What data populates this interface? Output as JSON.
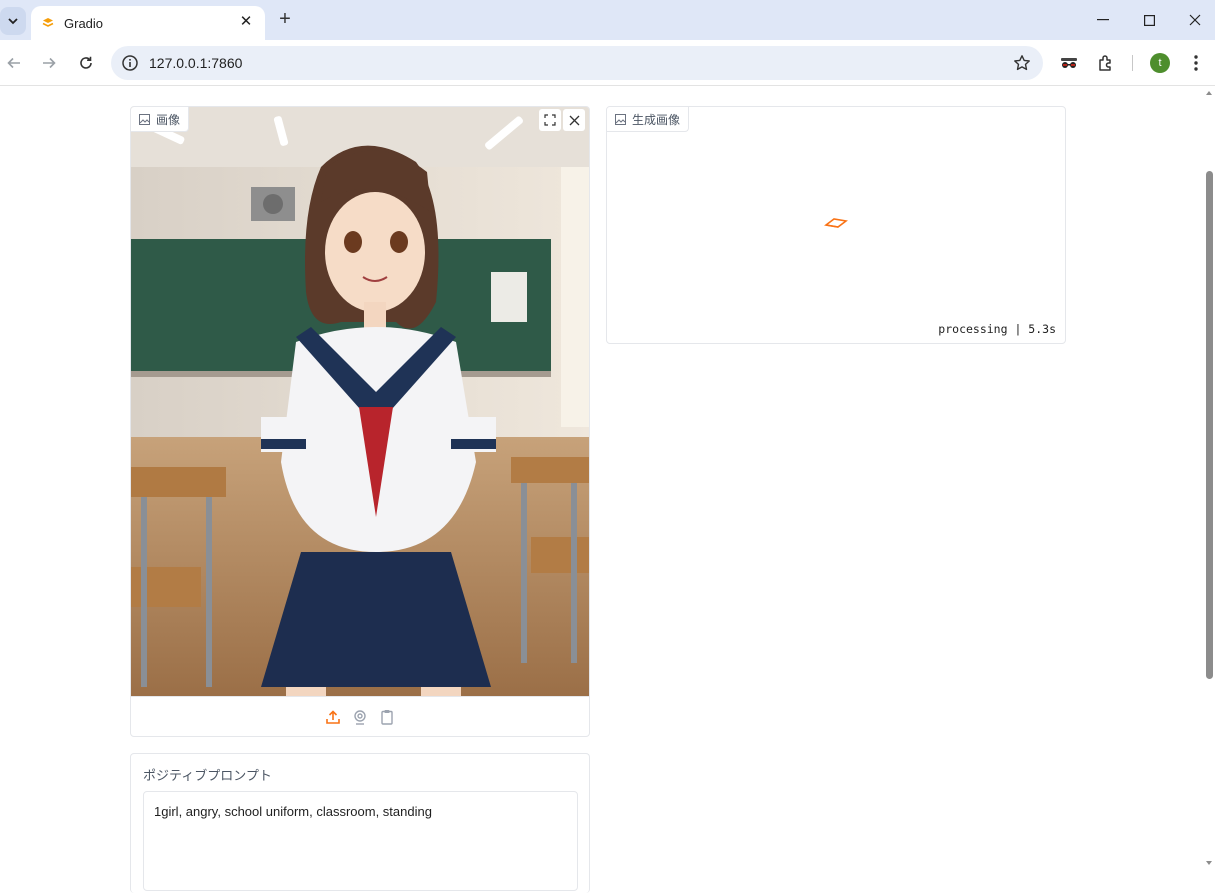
{
  "browser": {
    "tab_title": "Gradio",
    "url": "127.0.0.1:7860",
    "avatar_letter": "t",
    "icons": [
      "tab-search-icon",
      "gradio-favicon-icon",
      "close-icon",
      "plus-icon",
      "minimize-icon",
      "maximize-icon",
      "window-close-icon",
      "back-icon",
      "forward-icon",
      "reload-icon",
      "site-info-icon",
      "bookmark-star-icon",
      "incognito-icon",
      "extensions-icon",
      "kebab-menu-icon"
    ]
  },
  "input_image": {
    "label": "画像",
    "actions": [
      "fullscreen-icon",
      "clear-icon"
    ],
    "sources": [
      "upload-icon",
      "webcam-icon",
      "clipboard-icon"
    ],
    "accent_color": "#f97316"
  },
  "output_image": {
    "label": "生成画像",
    "status": "processing | 5.3s"
  },
  "prompt": {
    "label": "ポジティブプロンプト",
    "value": "1girl, angry, school uniform, classroom, standing"
  }
}
